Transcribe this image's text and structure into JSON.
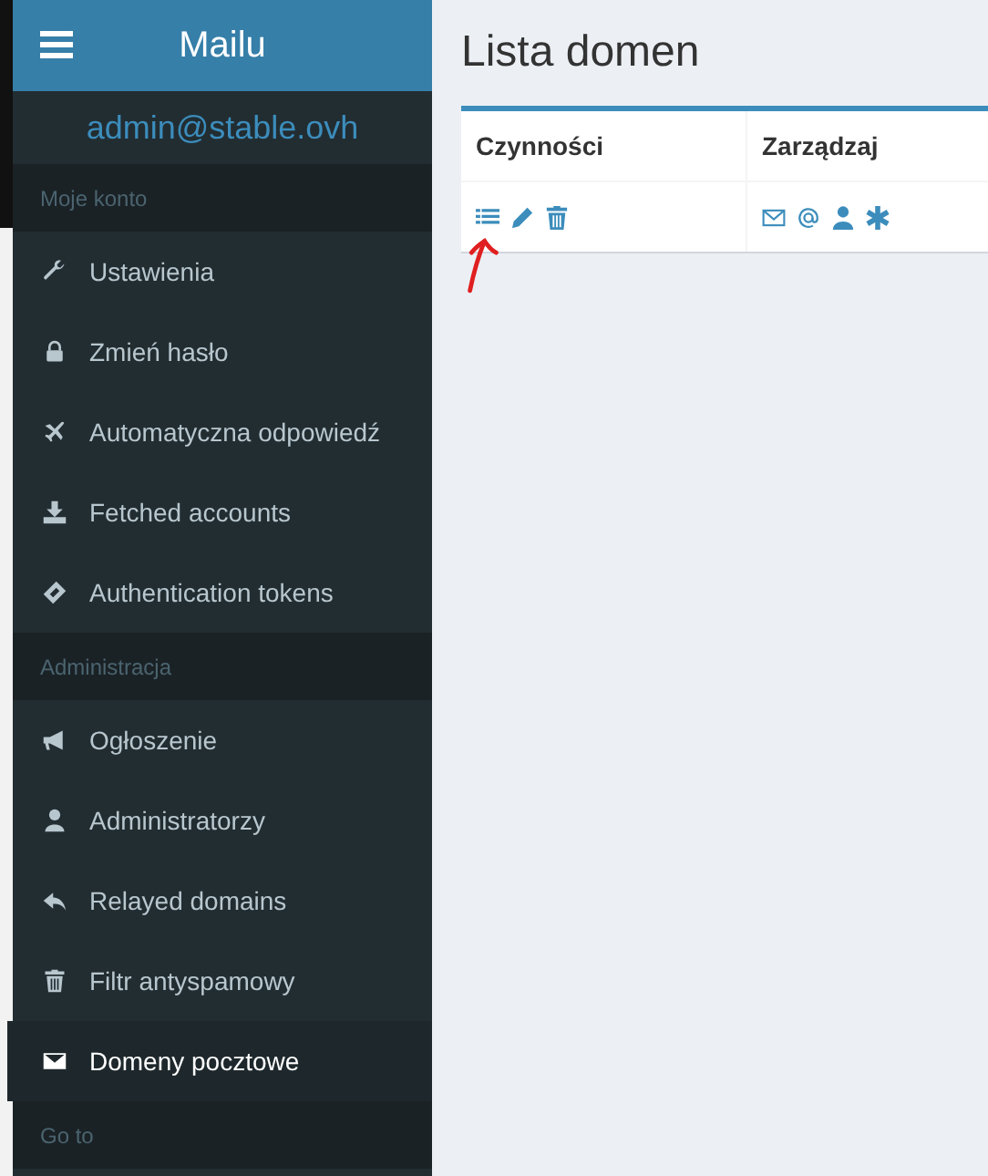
{
  "header": {
    "title": "Mailu"
  },
  "user": {
    "email": "admin@stable.ovh"
  },
  "sidebar": {
    "sections": [
      {
        "title": "Moje konto",
        "items": [
          {
            "label": "Ustawienia",
            "selected": false
          },
          {
            "label": "Zmień hasło",
            "selected": false
          },
          {
            "label": "Automatyczna odpowiedź",
            "selected": false
          },
          {
            "label": "Fetched accounts",
            "selected": false
          },
          {
            "label": "Authentication tokens",
            "selected": false
          }
        ]
      },
      {
        "title": "Administracja",
        "items": [
          {
            "label": "Ogłoszenie",
            "selected": false
          },
          {
            "label": "Administratorzy",
            "selected": false
          },
          {
            "label": "Relayed domains",
            "selected": false
          },
          {
            "label": "Filtr antyspamowy",
            "selected": false
          },
          {
            "label": "Domeny pocztowe",
            "selected": true
          }
        ]
      },
      {
        "title": "Go to"
      }
    ]
  },
  "page": {
    "title": "Lista domen"
  },
  "table": {
    "columns": [
      "Czynności",
      "Zarządzaj"
    ]
  }
}
